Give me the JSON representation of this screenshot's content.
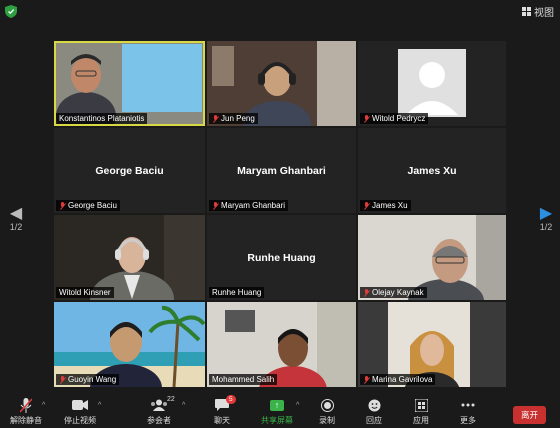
{
  "top": {
    "view_label": "视图"
  },
  "nav": {
    "page_left": "1/2",
    "page_right": "1/2"
  },
  "tiles": [
    {
      "name": "Konstantinos Plataniotis",
      "show_big": false,
      "muted": false,
      "active": true
    },
    {
      "name": "Jun Peng",
      "show_big": false,
      "muted": true
    },
    {
      "name": "Witold Pedrycz",
      "show_big": false,
      "muted": true
    },
    {
      "name": "George Baciu",
      "show_big": true,
      "muted": true
    },
    {
      "name": "Maryam Ghanbari",
      "show_big": true,
      "muted": true
    },
    {
      "name": "James Xu",
      "show_big": true,
      "muted": true
    },
    {
      "name": "Witold Kinsner",
      "show_big": false,
      "muted": false
    },
    {
      "name": "Runhe Huang",
      "show_big": true,
      "muted": false
    },
    {
      "name": "Olejay Kaynak",
      "show_big": false,
      "muted": true
    },
    {
      "name": "Guoyin Wang",
      "show_big": false,
      "muted": true
    },
    {
      "name": "Mohammed Salih",
      "show_big": false,
      "muted": false
    },
    {
      "name": "Marina Gavrilova",
      "show_big": false,
      "muted": true
    }
  ],
  "toolbar": {
    "unmute": "解除静音",
    "stop_video": "停止视频",
    "participants": "参会者",
    "participants_count": "22",
    "chat": "聊天",
    "chat_badge": "5",
    "share": "共享屏幕",
    "record": "录制",
    "react": "回应",
    "apps": "应用",
    "more": "更多",
    "leave": "离开"
  },
  "colors": {
    "active_border": "#d8d844",
    "share_green": "#3ab34a",
    "leave_red": "#c93131",
    "muted_red": "#e03a3a"
  },
  "icons": [
    "shield-icon",
    "grid-view-icon",
    "mic-muted-icon",
    "video-camera-icon",
    "participants-icon",
    "chat-icon",
    "share-screen-icon",
    "record-icon",
    "reaction-icon",
    "apps-icon",
    "more-icon"
  ]
}
